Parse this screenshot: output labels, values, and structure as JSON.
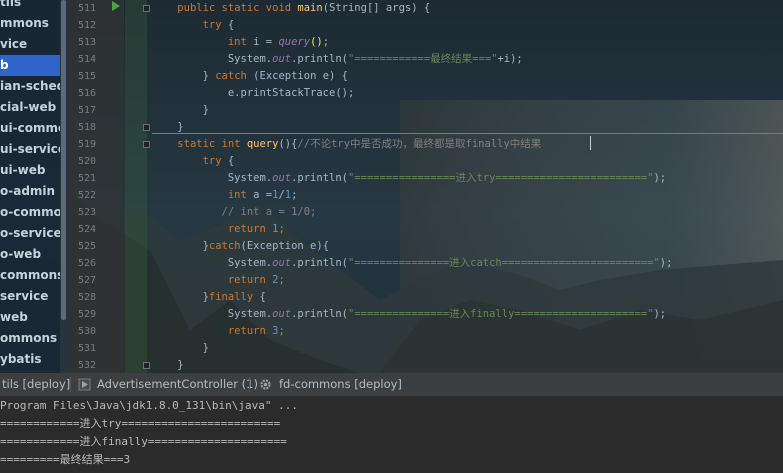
{
  "project_tree": {
    "items": [
      {
        "label": "tils",
        "selected": false
      },
      {
        "label": "mmons",
        "selected": false
      },
      {
        "label": "vice",
        "selected": false
      },
      {
        "label": "b",
        "selected": true
      },
      {
        "label": "ian-schedu",
        "selected": false
      },
      {
        "label": "cial-web",
        "selected": false
      },
      {
        "label": "ui-commor",
        "selected": false
      },
      {
        "label": "ui-service",
        "selected": false
      },
      {
        "label": "ui-web",
        "selected": false
      },
      {
        "label": "o-admin",
        "selected": false
      },
      {
        "label": "o-commons",
        "selected": false
      },
      {
        "label": "o-service",
        "selected": false
      },
      {
        "label": "o-web",
        "selected": false
      },
      {
        "label": "commons",
        "selected": false
      },
      {
        "label": "service",
        "selected": false
      },
      {
        "label": "web",
        "selected": false
      },
      {
        "label": "ommons",
        "selected": false
      },
      {
        "label": "ybatis",
        "selected": false
      }
    ]
  },
  "editor": {
    "line_numbers": [
      "511",
      "512",
      "513",
      "514",
      "515",
      "516",
      "517",
      "518",
      "519",
      "520",
      "521",
      "522",
      "523",
      "524",
      "525",
      "526",
      "527",
      "528",
      "529",
      "530",
      "531",
      "532"
    ],
    "lines": [
      {
        "indent": "    ",
        "tokens": [
          [
            "kw",
            "public static void "
          ],
          [
            "fn",
            "main"
          ],
          [
            "pa",
            "(String[] "
          ],
          [
            "pa",
            "args"
          ],
          [
            "pa",
            ") {"
          ]
        ]
      },
      {
        "indent": "        ",
        "tokens": [
          [
            "kw",
            "try "
          ],
          [
            "pa",
            "{"
          ]
        ]
      },
      {
        "indent": "            ",
        "tokens": [
          [
            "kw",
            "int "
          ],
          [
            "pa",
            "i = "
          ],
          [
            "it",
            "query"
          ],
          [
            "bh",
            "()"
          ],
          [
            "pa",
            ";"
          ]
        ]
      },
      {
        "indent": "            ",
        "tokens": [
          [
            "pa",
            "System."
          ],
          [
            "it",
            "out"
          ],
          [
            "pa",
            ".println("
          ],
          [
            "st",
            "\"============最终结果===\""
          ],
          [
            "pa",
            "+i);"
          ]
        ]
      },
      {
        "indent": "        ",
        "tokens": [
          [
            "pa",
            "} "
          ],
          [
            "kw",
            "catch "
          ],
          [
            "pa",
            "(Exception e) {"
          ]
        ]
      },
      {
        "indent": "            ",
        "tokens": [
          [
            "pa",
            "e.printStackTrace();"
          ]
        ]
      },
      {
        "indent": "        ",
        "tokens": [
          [
            "pa",
            "}"
          ]
        ]
      },
      {
        "indent": "    ",
        "tokens": [
          [
            "pa",
            "}"
          ]
        ]
      },
      {
        "indent": "    ",
        "tokens": [
          [
            "kw",
            "static int "
          ],
          [
            "fn",
            "query"
          ],
          [
            "pa",
            "(){"
          ],
          [
            "cm",
            "//不论try中是否成功，最终都是取finally中结果"
          ]
        ]
      },
      {
        "indent": "        ",
        "tokens": [
          [
            "kw",
            "try "
          ],
          [
            "pa",
            "{"
          ]
        ]
      },
      {
        "indent": "            ",
        "tokens": [
          [
            "pa",
            "System."
          ],
          [
            "it",
            "out"
          ],
          [
            "pa",
            ".println("
          ],
          [
            "st",
            "\"================进入try========================\""
          ],
          [
            "pa",
            ");"
          ]
        ]
      },
      {
        "indent": "            ",
        "tokens": [
          [
            "kw",
            "int "
          ],
          [
            "pa",
            "a ="
          ],
          [
            "nm",
            "1"
          ],
          [
            "pa",
            "/"
          ],
          [
            "nm",
            "1"
          ],
          [
            "pa",
            ";"
          ]
        ]
      },
      {
        "indent": "           ",
        "tokens": [
          [
            "cm",
            "// int a = 1/0;"
          ]
        ]
      },
      {
        "indent": "            ",
        "tokens": [
          [
            "kw",
            "return "
          ],
          [
            "nm",
            "1"
          ],
          [
            "kw",
            ";"
          ]
        ]
      },
      {
        "indent": "        ",
        "tokens": [
          [
            "pa",
            "}"
          ],
          [
            "kw",
            "catch"
          ],
          [
            "pa",
            "(Exception e){"
          ]
        ]
      },
      {
        "indent": "            ",
        "tokens": [
          [
            "pa",
            "System."
          ],
          [
            "it",
            "out"
          ],
          [
            "pa",
            ".println("
          ],
          [
            "st",
            "\"===============进入catch========================\""
          ],
          [
            "pa",
            ");"
          ]
        ]
      },
      {
        "indent": "            ",
        "tokens": [
          [
            "kw",
            "return "
          ],
          [
            "nm",
            "2"
          ],
          [
            "kw",
            ";"
          ]
        ]
      },
      {
        "indent": "        ",
        "tokens": [
          [
            "pa",
            "}"
          ],
          [
            "kw",
            "finally "
          ],
          [
            "pa",
            "{"
          ]
        ]
      },
      {
        "indent": "            ",
        "tokens": [
          [
            "pa",
            "System."
          ],
          [
            "it",
            "out"
          ],
          [
            "pa",
            ".println("
          ],
          [
            "st",
            "\"===============进入finally=====================\""
          ],
          [
            "pa",
            ");"
          ]
        ]
      },
      {
        "indent": "            ",
        "tokens": [
          [
            "kw",
            "return "
          ],
          [
            "nm",
            "3"
          ],
          [
            "kw",
            ";"
          ]
        ]
      },
      {
        "indent": "        ",
        "tokens": [
          [
            "pa",
            "}"
          ]
        ]
      },
      {
        "indent": "    ",
        "tokens": [
          [
            "pa",
            "}"
          ]
        ]
      }
    ]
  },
  "run_tabs": {
    "tab1_label": "tils [deploy]",
    "tab2_label": "AdvertisementController (1)",
    "tab3_label": "fd-commons [deploy]"
  },
  "console": {
    "lines": [
      "Program Files\\Java\\jdk1.8.0_131\\bin\\java\" ...",
      "============进入try========================",
      "============进入finally=====================",
      "=========最终结果===3"
    ]
  },
  "colors": {
    "keyword": "#cc7832",
    "function": "#ffc66d",
    "string": "#6a8759",
    "number": "#6897bb",
    "static_field": "#9876aa",
    "comment": "#808080",
    "selection": "#2f65ca"
  }
}
